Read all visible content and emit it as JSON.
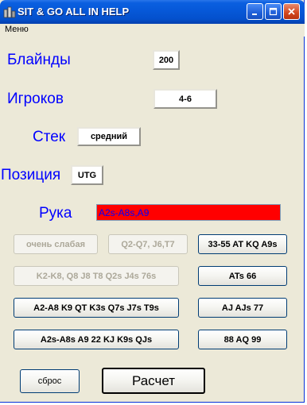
{
  "window": {
    "title": "SIT & GO ALL IN HELP"
  },
  "menubar": {
    "menu_label": "Меню"
  },
  "blinds": {
    "label": "Блайнды",
    "value": "200"
  },
  "players": {
    "label": "Игроков",
    "value": "4-6"
  },
  "stack": {
    "label": "Стек",
    "value": "средний"
  },
  "position": {
    "label": "Позиция",
    "value": "UTG"
  },
  "hand": {
    "label": "Рука",
    "value": "A2s-A8s,A9"
  },
  "ranges": {
    "very_weak": "очень слабая",
    "q2_q7": "Q2-Q7, J6,T7",
    "r_33_55": "33-55 AT KQ A9s",
    "k2_k8": "K2-K8, Q8 J8 T8  Q2s J4s 76s",
    "ats_66": "ATs 66",
    "a2_a8": "A2-A8 K9 QT K3s Q7s J7s T9s",
    "aj_ajs": "AJ AJs 77",
    "a2s_a8s": "A2s-A8s A9 22 KJ K9s QJs",
    "r_88_aq": "88 AQ 99"
  },
  "actions": {
    "reset": "сброс",
    "calculate": "Расчет"
  },
  "colors": {
    "label_blue": "#0000ff",
    "hand_field_bg": "#ff0000",
    "window_bg": "#ece9d8",
    "titlebar_blue": "#0658d8"
  }
}
